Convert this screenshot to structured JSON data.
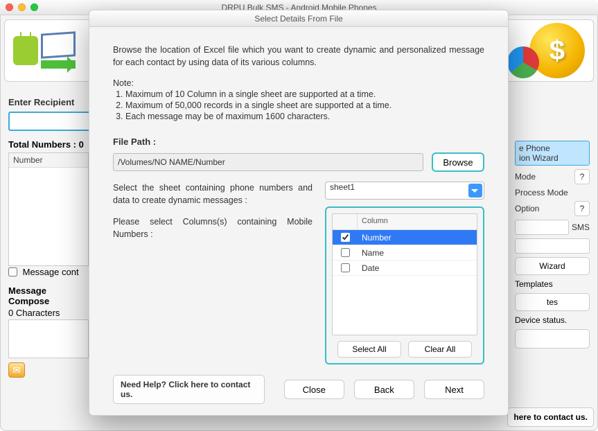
{
  "app": {
    "window_title": "DRPU Bulk SMS - Android Mobile Phones",
    "coin_glyph": "$"
  },
  "left_panel": {
    "enter_recipient_label": "Enter Recipient",
    "total_numbers_label": "Total Numbers : 0",
    "list_header": "Number",
    "msg_contains_label": "Message cont",
    "composer_label": "Message Compose",
    "char_count": "0 Characters"
  },
  "right_panel": {
    "row1a": "e Phone",
    "row1b": "ion  Wizard",
    "row_mode": "Mode",
    "row_processmode": "Process Mode",
    "row_option": "Option",
    "row_sms": "SMS",
    "btn_wizard": "Wizard",
    "txt_templates": "Templates",
    "btn_tes": "tes",
    "txt_devicestatus": "Device status.",
    "contact": "here to contact us."
  },
  "modal": {
    "title": "Select Details From File",
    "description": "Browse the location of Excel file which you want to create dynamic and personalized message for each contact by using data of its various columns.",
    "note_heading": "Note:",
    "notes": [
      "Maximum of 10 Column in a single sheet are supported at a time.",
      "Maximum of 50,000 records in a single sheet are supported at a time.",
      "Each message may be of maximum 1600 characters."
    ],
    "file_path_label": "File Path :",
    "file_path_value": "/Volumes/NO NAME/Number",
    "browse_label": "Browse",
    "select_sheet_text": "Select the sheet containing phone numbers and data to create dynamic messages :",
    "select_cols_text": "Please select Columns(s) containing Mobile Numbers :",
    "sheet_selected": "sheet1",
    "column_header": "Column",
    "columns": [
      {
        "label": "Number",
        "checked": true,
        "selected": true
      },
      {
        "label": "Name",
        "checked": false,
        "selected": false
      },
      {
        "label": "Date",
        "checked": false,
        "selected": false
      }
    ],
    "select_all": "Select All",
    "clear_all": "Clear All",
    "need_help": "Need Help? Click here to contact us.",
    "nav": {
      "close": "Close",
      "back": "Back",
      "next": "Next"
    }
  }
}
